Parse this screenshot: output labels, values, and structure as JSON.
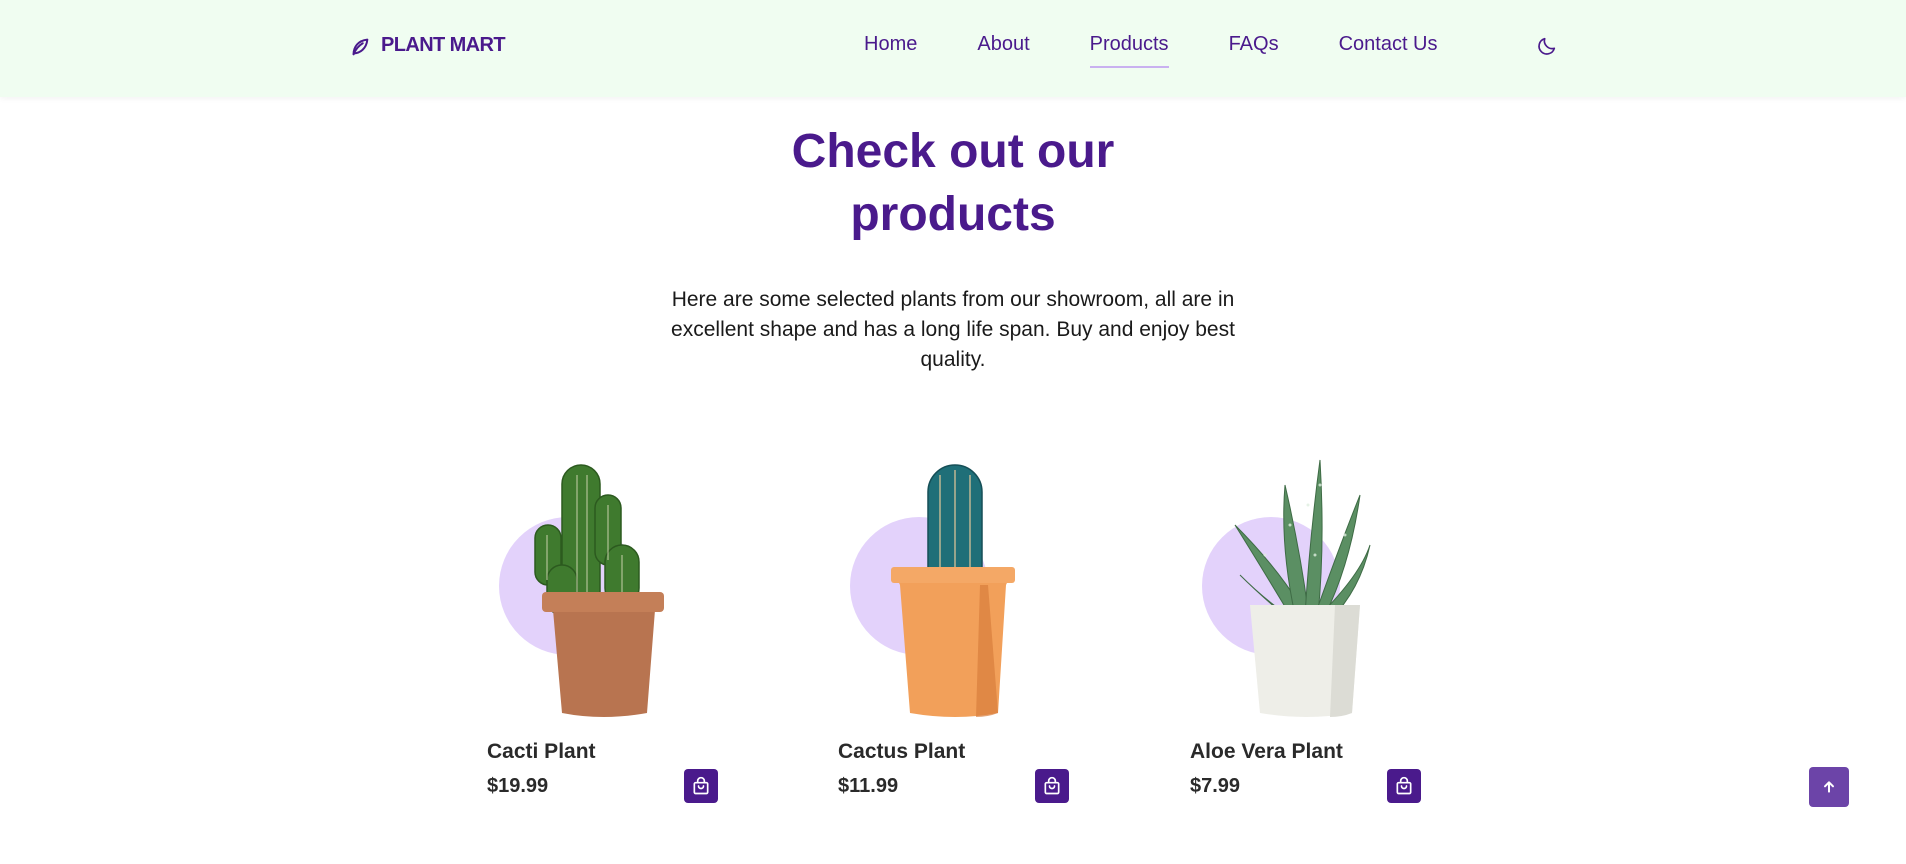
{
  "brand": {
    "name": "PLANT MART",
    "icon": "leaf-icon",
    "color": "#4a1a8c"
  },
  "nav": {
    "items": [
      {
        "label": "Home",
        "active": false
      },
      {
        "label": "About",
        "active": false
      },
      {
        "label": "Products",
        "active": true
      },
      {
        "label": "FAQs",
        "active": false
      },
      {
        "label": "Contact Us",
        "active": false
      }
    ],
    "theme_toggle_icon": "moon-icon"
  },
  "section": {
    "title_line1": "Check out our",
    "title_line2": "products",
    "description": "Here are some selected plants from our showroom, all are in excellent shape and has a long life span. Buy and enjoy best quality."
  },
  "products": [
    {
      "name": "Cacti Plant",
      "price": "$19.99",
      "pot": "terracotta",
      "cart_icon": "shopping-bag-icon"
    },
    {
      "name": "Cactus Plant",
      "price": "$11.99",
      "pot": "orange",
      "cart_icon": "shopping-bag-icon"
    },
    {
      "name": "Aloe Vera Plant",
      "price": "$7.99",
      "pot": "white",
      "cart_icon": "shopping-bag-icon"
    }
  ],
  "scroll_top": {
    "icon": "arrow-up-icon"
  },
  "colors": {
    "header_bg": "#f0fdf1",
    "accent": "#4a1a8c",
    "circle": "#e3d2fb",
    "scroll_btn": "#6c44a8"
  }
}
